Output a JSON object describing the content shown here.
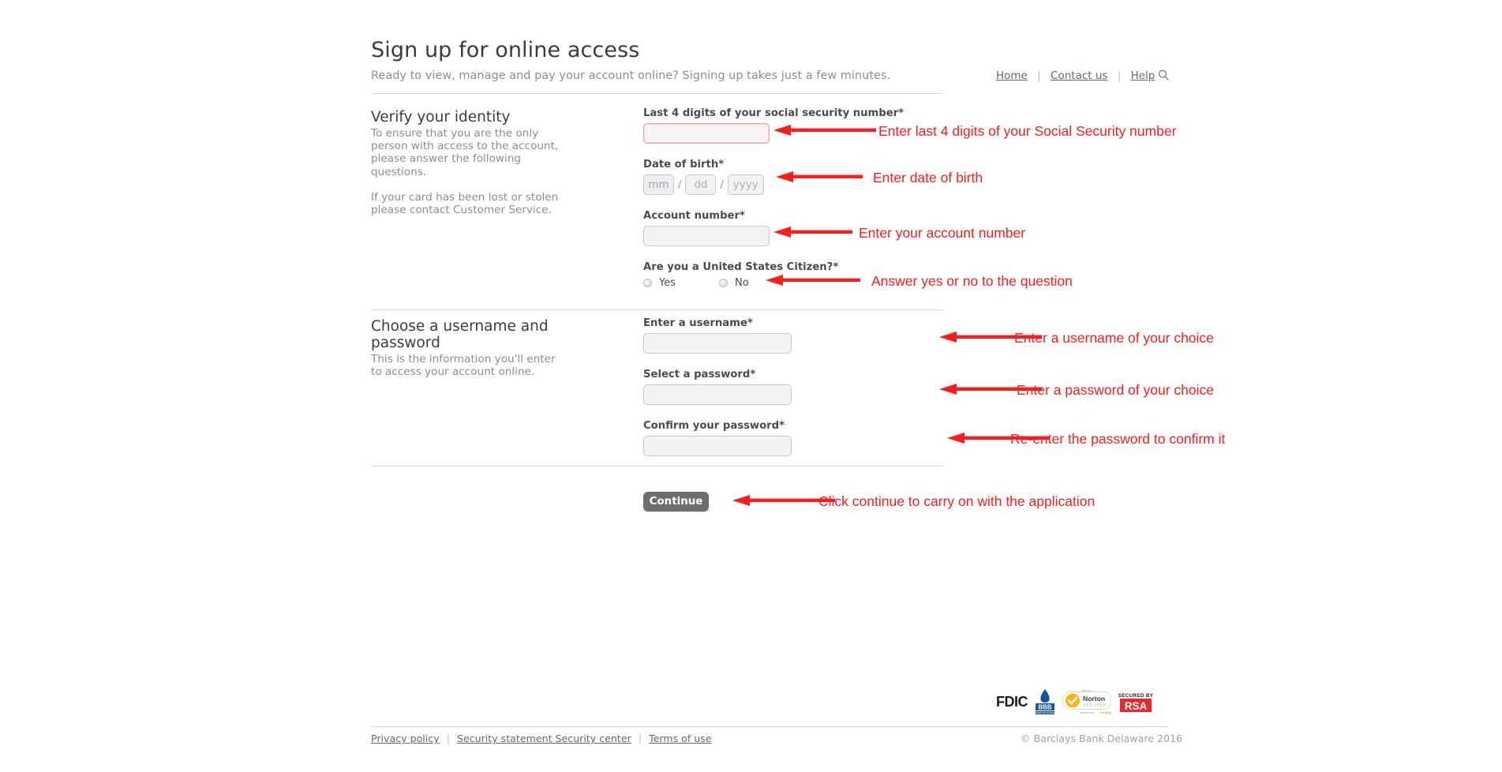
{
  "header": {
    "title": "Sign up for online access",
    "subtitle": "Ready to view, manage and pay your account online? Signing up takes just a few minutes.",
    "nav": {
      "home": "Home",
      "contact": "Contact us",
      "help": "Help",
      "separator": "|",
      "search_icon": "magnifier-icon"
    }
  },
  "section_identity": {
    "heading": "Verify your identity",
    "paragraph1": "To ensure that you are the only person with access to the account, please answer the following questions.",
    "paragraph2": "If your card has been lost or stolen please contact Customer Service.",
    "fields": {
      "ssn_label": "Last 4 digits of your social security number*",
      "ssn_value": "",
      "dob_label": "Date of birth*",
      "dob_mm_placeholder": "mm",
      "dob_dd_placeholder": "dd",
      "dob_yyyy_placeholder": "yyyy",
      "dob_separator": "/",
      "account_label": "Account number*",
      "account_value": "",
      "citizen_label": "Are you a United States Citizen?*",
      "citizen_yes": "Yes",
      "citizen_no": "No"
    }
  },
  "section_credentials": {
    "heading": "Choose a username and password",
    "paragraph1": "This is the information you'll enter to access your account online.",
    "fields": {
      "username_label": "Enter a username*",
      "username_value": "",
      "password_label": "Select a password*",
      "password_value": "",
      "confirm_label": "Confirm your password*",
      "confirm_value": ""
    }
  },
  "actions": {
    "continue_label": "Continue"
  },
  "annotations": [
    {
      "text": "Enter last 4 digits of your Social Security number"
    },
    {
      "text": "Enter date of birth"
    },
    {
      "text": "Enter your account number"
    },
    {
      "text": "Answer yes or no to the question"
    },
    {
      "text": "Enter a username of your choice"
    },
    {
      "text": "Enter a password of your choice"
    },
    {
      "text": "Re-enter the password to confirm it"
    },
    {
      "text": "Click continue to carry on with the application"
    }
  ],
  "badges": {
    "fdic": "FDIC",
    "bbb_top": "BBB",
    "bbb_sub": "ACCREDITED BUSINESS",
    "norton_small": "SECURITY",
    "norton_title": "Norton",
    "norton_sub": "SECURED",
    "norton_powered": "powered by VeriSign",
    "rsa_top": "SECURED BY",
    "rsa_title": "RSA"
  },
  "footer": {
    "privacy": "Privacy policy",
    "security": "Security statement Security center",
    "terms": "Terms of use",
    "separator": "|",
    "copyright": "© Barclays Bank Delaware 2016"
  },
  "colors": {
    "annotation_red": "#fd1c1c",
    "error_border": "#f0a0a0",
    "button": "#6e6e6e"
  }
}
